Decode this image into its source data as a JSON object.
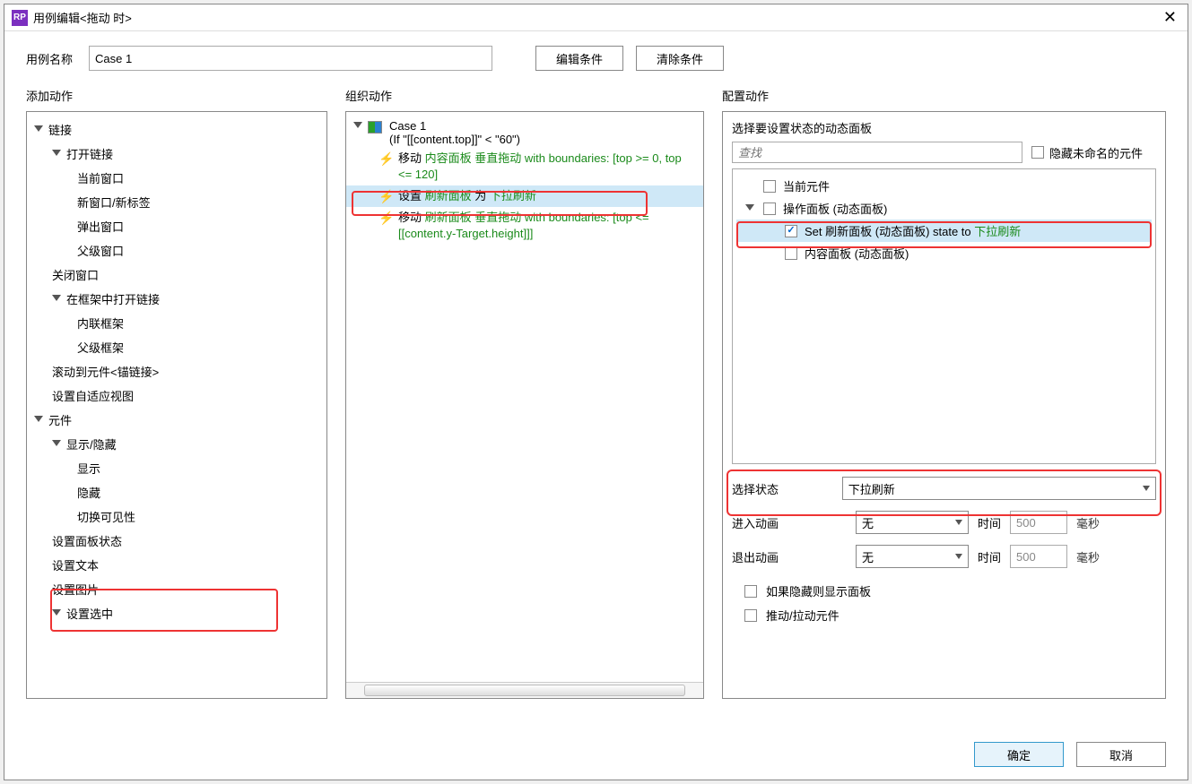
{
  "title": "用例编辑<拖动 时>",
  "top": {
    "name_label": "用例名称",
    "name_value": "Case 1",
    "edit_cond": "编辑条件",
    "clear_cond": "清除条件"
  },
  "headers": {
    "add": "添加动作",
    "org": "组织动作",
    "cfg": "配置动作"
  },
  "actions_tree": {
    "link": "链接",
    "open_link": "打开链接",
    "current_window": "当前窗口",
    "new_window": "新窗口/新标签",
    "popup": "弹出窗口",
    "parent_window": "父级窗口",
    "close_window": "关闭窗口",
    "open_in_frame": "在框架中打开链接",
    "inline_frame": "内联框架",
    "parent_frame": "父级框架",
    "scroll_to": "滚动到元件<锚链接>",
    "adaptive_view": "设置自适应视图",
    "widgets": "元件",
    "show_hide": "显示/隐藏",
    "show": "显示",
    "hide": "隐藏",
    "toggle": "切换可见性",
    "set_panel_state": "设置面板状态",
    "set_text": "设置文本",
    "set_image": "设置图片",
    "set_selected": "设置选中"
  },
  "case": {
    "name": "Case 1",
    "cond": "(If \"[[content.top]]\" < \"60\")",
    "a1_pre": "移动 ",
    "a1_target": "内容面板",
    "a1_post": " 垂直拖动 with boundaries: [top >= 0, top <= 120]",
    "a2_pre": "设置 ",
    "a2_target": "刷新面板",
    "a2_mid": " 为 ",
    "a2_state": "下拉刷新",
    "a3_pre": "移动 ",
    "a3_target": "刷新面板",
    "a3_post": " 垂直拖动 with boundaries: [top <= [[content.y-Target.height]]]"
  },
  "cfg": {
    "title": "选择要设置状态的动态面板",
    "search_ph": "查找",
    "hide_unnamed": "隐藏未命名的元件",
    "current_widget": "当前元件",
    "op_panel": "操作面板 (动态面板)",
    "set_row_pre": "Set 刷新面板 (动态面板) state to ",
    "set_row_state": "下拉刷新",
    "content_panel": "内容面板 (动态面板)",
    "select_state": "选择状态",
    "state_value": "下拉刷新",
    "anim_in": "进入动画",
    "anim_out": "退出动画",
    "none": "无",
    "time": "时间",
    "time_val": "500",
    "ms": "毫秒",
    "show_if_hidden": "如果隐藏则显示面板",
    "push_pull": "推动/拉动元件"
  },
  "footer": {
    "ok": "确定",
    "cancel": "取消"
  }
}
